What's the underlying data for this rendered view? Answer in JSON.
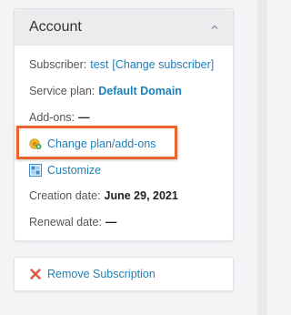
{
  "account": {
    "title": "Account",
    "subscriber_label": "Subscriber:",
    "subscriber_value": "test",
    "change_subscriber": "[Change subscriber]",
    "service_plan_label": "Service plan:",
    "service_plan_value": "Default Domain",
    "addons_label": "Add-ons:",
    "addons_value": "—",
    "change_plan_link": "Change plan/add-ons",
    "customize_link": "Customize",
    "creation_label": "Creation date:",
    "creation_value": "June 29, 2021",
    "renewal_label": "Renewal date:",
    "renewal_value": "—"
  },
  "actions": {
    "remove_subscription": "Remove Subscription"
  },
  "icons": {
    "collapse": "chevron-up-icon",
    "change_plan": "change-plan-icon",
    "customize": "customize-icon",
    "remove": "close-icon"
  },
  "colors": {
    "link": "#1c7fb6",
    "highlight": "#e8662e",
    "remove_x": "#e0553e"
  }
}
